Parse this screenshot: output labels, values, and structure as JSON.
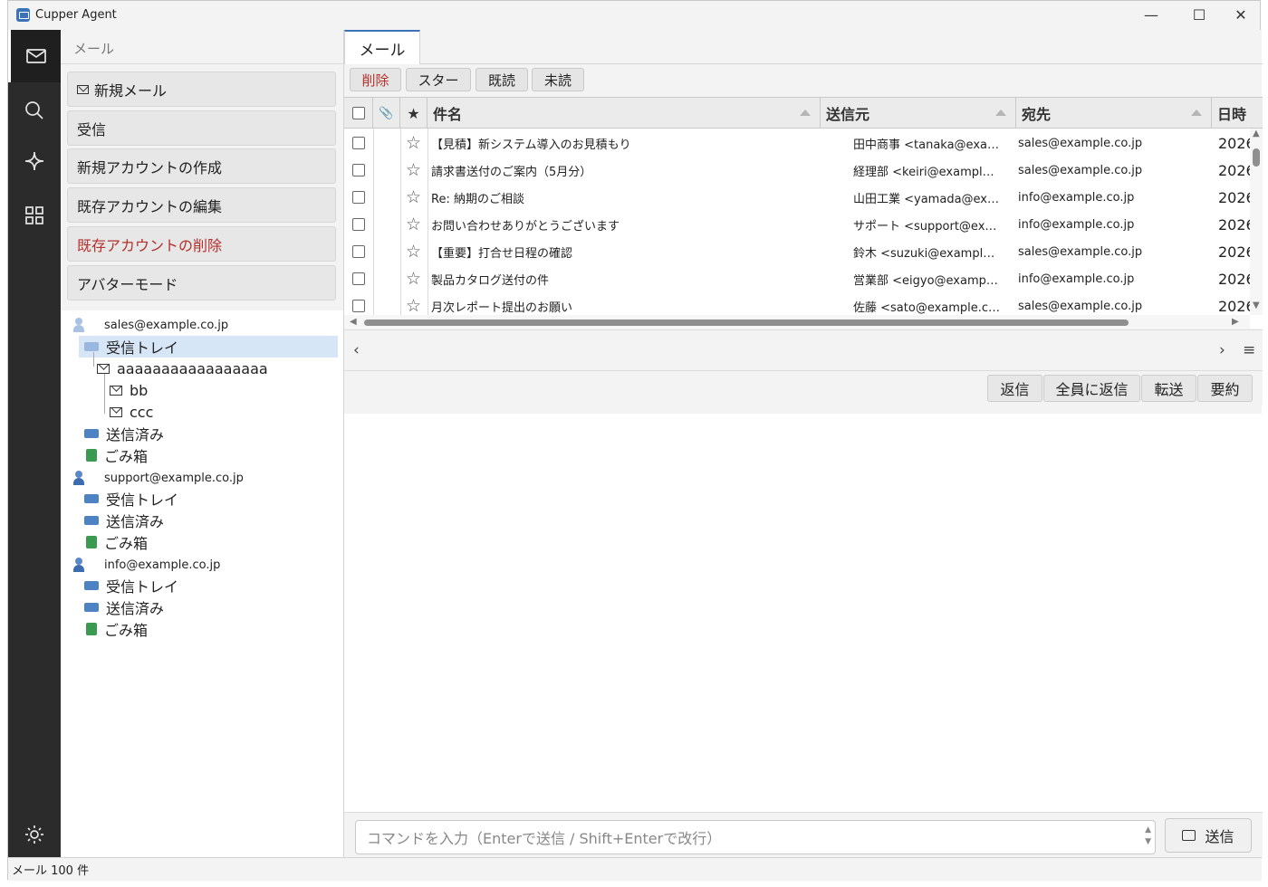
{
  "app": {
    "title": "Cupper Agent"
  },
  "window_controls": {
    "minimize": "—",
    "maximize": "☐",
    "close": "✕"
  },
  "rail": [
    "mail-icon",
    "search-icon",
    "sparkle-icon",
    "grid-icon",
    "settings-icon"
  ],
  "sidebar": {
    "header": "メール",
    "buttons": {
      "new_mail": "新規メール",
      "receive": "受信",
      "create_account": "新規アカウントの作成",
      "edit_account": "既存アカウントの編集",
      "delete_account": "既存アカウントの削除",
      "avatar_mode": "アバターモード"
    },
    "accounts": [
      {
        "email": "sales@example.co.jp",
        "inbox": "受信トレイ",
        "subfolder": "aaaaaaaaaaaaaaaaa",
        "subfolders": [
          "bb",
          "ccc"
        ],
        "sent": "送信済み",
        "trash": "ごみ箱"
      },
      {
        "email": "support@example.co.jp",
        "inbox": "受信トレイ",
        "sent": "送信済み",
        "trash": "ごみ箱"
      },
      {
        "email": "info@example.co.jp",
        "inbox": "受信トレイ",
        "sent": "送信済み",
        "trash": "ごみ箱"
      }
    ]
  },
  "main": {
    "tab": "メール",
    "toolbar": {
      "delete": "削除",
      "star": "スター",
      "read": "既読",
      "unread": "未読"
    },
    "columns": {
      "attach": "📎",
      "star": "★",
      "subject": "件名",
      "from": "送信元",
      "to": "宛先",
      "date": "日時"
    },
    "rows": [
      {
        "subject": "【見積】新システム導入のお見積もり",
        "from": "田中商事  <tanaka@exa…",
        "to": "sales@example.co.jp",
        "date": "2026"
      },
      {
        "subject": "請求書送付のご案内（5月分）",
        "from": "経理部  <keiri@exampl…",
        "to": "sales@example.co.jp",
        "date": "2026"
      },
      {
        "subject": "Re: 納期のご相談",
        "from": "山田工業  <yamada@ex…",
        "to": "info@example.co.jp",
        "date": "2026"
      },
      {
        "subject": "お問い合わせありがとうございます",
        "from": "サポート  <support@ex…",
        "to": "info@example.co.jp",
        "date": "2026"
      },
      {
        "subject": "【重要】打合せ日程の確認",
        "from": "鈴木  <suzuki@exampl…",
        "to": "sales@example.co.jp",
        "date": "2026"
      },
      {
        "subject": "製品カタログ送付の件",
        "from": "営業部  <eigyo@examp…",
        "to": "info@example.co.jp",
        "date": "2026"
      },
      {
        "subject": "月次レポート提出のお願い",
        "from": "佐藤  <sato@example.c…",
        "to": "sales@example.co.jp",
        "date": "2026"
      }
    ],
    "star_glyph": "☆",
    "pager": {
      "prev": "‹",
      "next": "›",
      "menu": "≡"
    },
    "actions": {
      "reply": "返信",
      "reply_all": "全員に返信",
      "forward": "転送",
      "summary": "要約"
    },
    "command": {
      "placeholder": "コマンドを入力（Enterで送信 / Shift+Enterで改行）",
      "send": "送信"
    }
  },
  "status": "メール 100 件"
}
